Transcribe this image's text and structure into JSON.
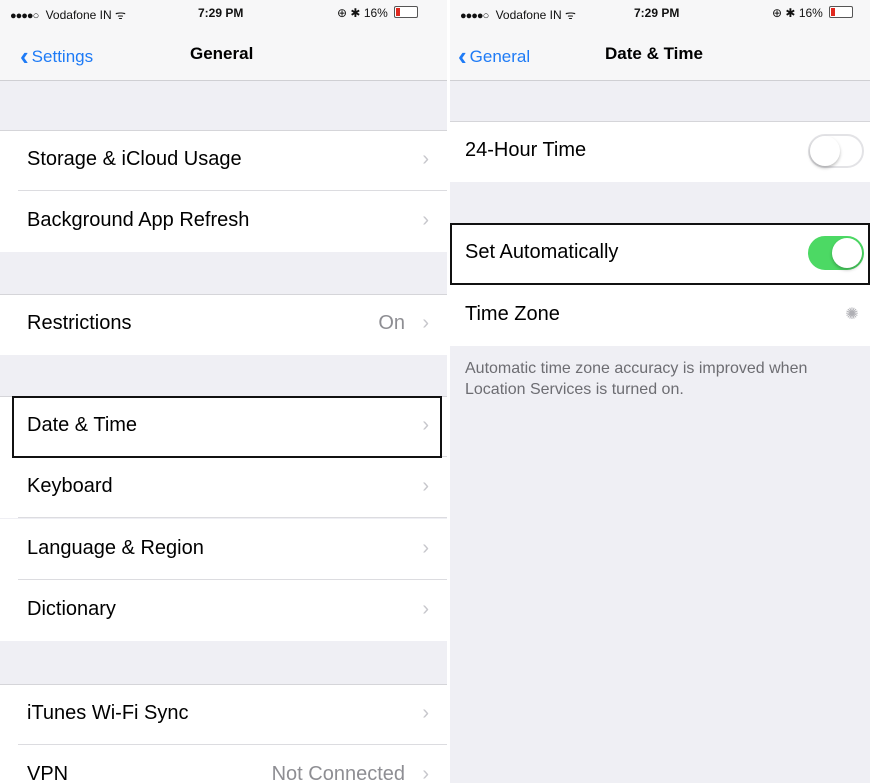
{
  "left": {
    "status": {
      "carrier": "Vodafone IN",
      "signal": "●●●●○",
      "time": "7:29 PM",
      "battery": "16%"
    },
    "nav": {
      "back": "Settings",
      "title": "General"
    },
    "rows": [
      {
        "label": "Storage & iCloud Usage"
      },
      {
        "label": "Background App Refresh"
      },
      {
        "label": "Restrictions",
        "value": "On"
      },
      {
        "label": "Date & Time"
      },
      {
        "label": "Keyboard"
      },
      {
        "label": "Language & Region"
      },
      {
        "label": "Dictionary"
      },
      {
        "label": "iTunes Wi-Fi Sync"
      },
      {
        "label": "VPN",
        "value": "Not Connected"
      }
    ]
  },
  "right": {
    "status": {
      "carrier": "Vodafone IN",
      "signal": "●●●●○",
      "time": "7:29 PM",
      "battery": "16%"
    },
    "nav": {
      "back": "General",
      "title": "Date & Time"
    },
    "rows": [
      {
        "label": "24-Hour Time",
        "toggle": "off"
      },
      {
        "label": "Set Automatically",
        "toggle": "on"
      },
      {
        "label": "Time Zone"
      }
    ],
    "footer": "Automatic time zone accuracy is improved when Location Services is turned on."
  },
  "icons": {
    "back": "chevron-left-icon",
    "disclosure": "chevron-right-icon",
    "wifi": "wifi-icon",
    "bluetooth": "bluetooth-icon",
    "battery": "battery-icon",
    "loading": "spinner-icon"
  },
  "colors": {
    "accent": "#1e7bf6",
    "toggle_on": "#4cd964",
    "battery_low": "#e0291f"
  }
}
